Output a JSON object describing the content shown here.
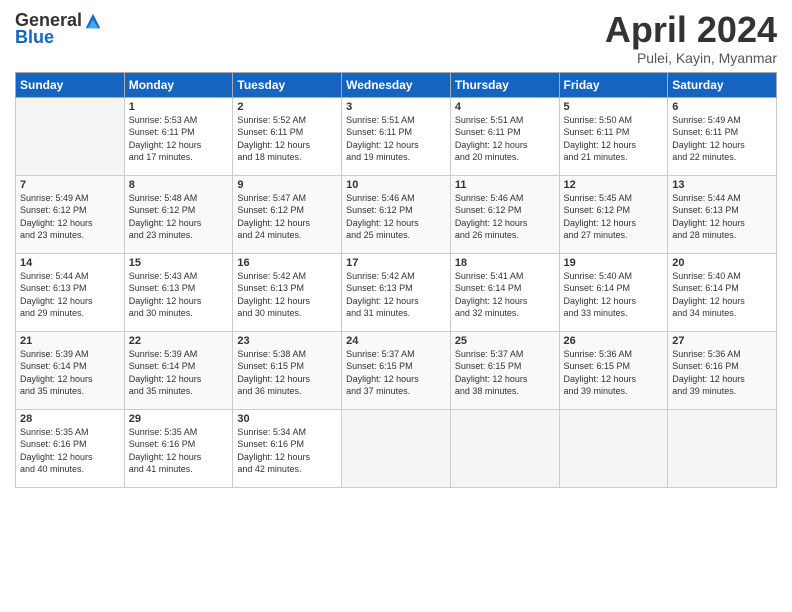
{
  "header": {
    "logo_general": "General",
    "logo_blue": "Blue",
    "month_title": "April 2024",
    "location": "Pulei, Kayin, Myanmar"
  },
  "calendar": {
    "headers": [
      "Sunday",
      "Monday",
      "Tuesday",
      "Wednesday",
      "Thursday",
      "Friday",
      "Saturday"
    ],
    "weeks": [
      [
        {
          "day": "",
          "info": ""
        },
        {
          "day": "1",
          "info": "Sunrise: 5:53 AM\nSunset: 6:11 PM\nDaylight: 12 hours\nand 17 minutes."
        },
        {
          "day": "2",
          "info": "Sunrise: 5:52 AM\nSunset: 6:11 PM\nDaylight: 12 hours\nand 18 minutes."
        },
        {
          "day": "3",
          "info": "Sunrise: 5:51 AM\nSunset: 6:11 PM\nDaylight: 12 hours\nand 19 minutes."
        },
        {
          "day": "4",
          "info": "Sunrise: 5:51 AM\nSunset: 6:11 PM\nDaylight: 12 hours\nand 20 minutes."
        },
        {
          "day": "5",
          "info": "Sunrise: 5:50 AM\nSunset: 6:11 PM\nDaylight: 12 hours\nand 21 minutes."
        },
        {
          "day": "6",
          "info": "Sunrise: 5:49 AM\nSunset: 6:11 PM\nDaylight: 12 hours\nand 22 minutes."
        }
      ],
      [
        {
          "day": "7",
          "info": "Sunrise: 5:49 AM\nSunset: 6:12 PM\nDaylight: 12 hours\nand 23 minutes."
        },
        {
          "day": "8",
          "info": "Sunrise: 5:48 AM\nSunset: 6:12 PM\nDaylight: 12 hours\nand 23 minutes."
        },
        {
          "day": "9",
          "info": "Sunrise: 5:47 AM\nSunset: 6:12 PM\nDaylight: 12 hours\nand 24 minutes."
        },
        {
          "day": "10",
          "info": "Sunrise: 5:46 AM\nSunset: 6:12 PM\nDaylight: 12 hours\nand 25 minutes."
        },
        {
          "day": "11",
          "info": "Sunrise: 5:46 AM\nSunset: 6:12 PM\nDaylight: 12 hours\nand 26 minutes."
        },
        {
          "day": "12",
          "info": "Sunrise: 5:45 AM\nSunset: 6:12 PM\nDaylight: 12 hours\nand 27 minutes."
        },
        {
          "day": "13",
          "info": "Sunrise: 5:44 AM\nSunset: 6:13 PM\nDaylight: 12 hours\nand 28 minutes."
        }
      ],
      [
        {
          "day": "14",
          "info": "Sunrise: 5:44 AM\nSunset: 6:13 PM\nDaylight: 12 hours\nand 29 minutes."
        },
        {
          "day": "15",
          "info": "Sunrise: 5:43 AM\nSunset: 6:13 PM\nDaylight: 12 hours\nand 30 minutes."
        },
        {
          "day": "16",
          "info": "Sunrise: 5:42 AM\nSunset: 6:13 PM\nDaylight: 12 hours\nand 30 minutes."
        },
        {
          "day": "17",
          "info": "Sunrise: 5:42 AM\nSunset: 6:13 PM\nDaylight: 12 hours\nand 31 minutes."
        },
        {
          "day": "18",
          "info": "Sunrise: 5:41 AM\nSunset: 6:14 PM\nDaylight: 12 hours\nand 32 minutes."
        },
        {
          "day": "19",
          "info": "Sunrise: 5:40 AM\nSunset: 6:14 PM\nDaylight: 12 hours\nand 33 minutes."
        },
        {
          "day": "20",
          "info": "Sunrise: 5:40 AM\nSunset: 6:14 PM\nDaylight: 12 hours\nand 34 minutes."
        }
      ],
      [
        {
          "day": "21",
          "info": "Sunrise: 5:39 AM\nSunset: 6:14 PM\nDaylight: 12 hours\nand 35 minutes."
        },
        {
          "day": "22",
          "info": "Sunrise: 5:39 AM\nSunset: 6:14 PM\nDaylight: 12 hours\nand 35 minutes."
        },
        {
          "day": "23",
          "info": "Sunrise: 5:38 AM\nSunset: 6:15 PM\nDaylight: 12 hours\nand 36 minutes."
        },
        {
          "day": "24",
          "info": "Sunrise: 5:37 AM\nSunset: 6:15 PM\nDaylight: 12 hours\nand 37 minutes."
        },
        {
          "day": "25",
          "info": "Sunrise: 5:37 AM\nSunset: 6:15 PM\nDaylight: 12 hours\nand 38 minutes."
        },
        {
          "day": "26",
          "info": "Sunrise: 5:36 AM\nSunset: 6:15 PM\nDaylight: 12 hours\nand 39 minutes."
        },
        {
          "day": "27",
          "info": "Sunrise: 5:36 AM\nSunset: 6:16 PM\nDaylight: 12 hours\nand 39 minutes."
        }
      ],
      [
        {
          "day": "28",
          "info": "Sunrise: 5:35 AM\nSunset: 6:16 PM\nDaylight: 12 hours\nand 40 minutes."
        },
        {
          "day": "29",
          "info": "Sunrise: 5:35 AM\nSunset: 6:16 PM\nDaylight: 12 hours\nand 41 minutes."
        },
        {
          "day": "30",
          "info": "Sunrise: 5:34 AM\nSunset: 6:16 PM\nDaylight: 12 hours\nand 42 minutes."
        },
        {
          "day": "",
          "info": ""
        },
        {
          "day": "",
          "info": ""
        },
        {
          "day": "",
          "info": ""
        },
        {
          "day": "",
          "info": ""
        }
      ]
    ]
  }
}
